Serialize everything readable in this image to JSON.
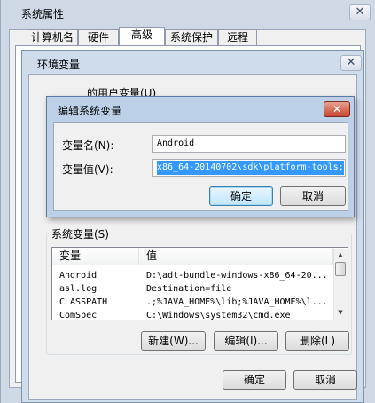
{
  "system_properties": {
    "title": "系统属性",
    "tabs": [
      "计算机名",
      "硬件",
      "高级",
      "系统保护",
      "远程"
    ],
    "active_tab": "高级"
  },
  "environment_variables": {
    "title": "环境变量",
    "user_vars_label": "的用户变量(U)",
    "system_vars_label": "系统变量(S)",
    "columns": {
      "name": "变量",
      "value": "值"
    },
    "rows": [
      {
        "name": "Android",
        "value": "D:\\adt-bundle-windows-x86_64-20..."
      },
      {
        "name": "asl.log",
        "value": "Destination=file"
      },
      {
        "name": "CLASSPATH",
        "value": ".;%JAVA_HOME%\\lib;%JAVA_HOME%\\l..."
      },
      {
        "name": "ComSpec",
        "value": "C:\\Windows\\system32\\cmd.exe"
      }
    ],
    "buttons": {
      "new": "新建(W)...",
      "edit": "编辑(I)...",
      "delete": "删除(L)"
    },
    "ok": "确定",
    "cancel": "取消"
  },
  "edit_dialog": {
    "title": "编辑系统变量",
    "name_label": "变量名(N):",
    "name_value": "Android",
    "value_label": "变量值(V):",
    "value_value": "x86_64-20140702\\sdk\\platform-tools;",
    "ok": "确定",
    "cancel": "取消"
  },
  "colors": {
    "title_bar": "#cfdcec",
    "dialog_bar": "#bcd0e8",
    "selection": "#3399ff",
    "close_red": "#c6452f"
  }
}
